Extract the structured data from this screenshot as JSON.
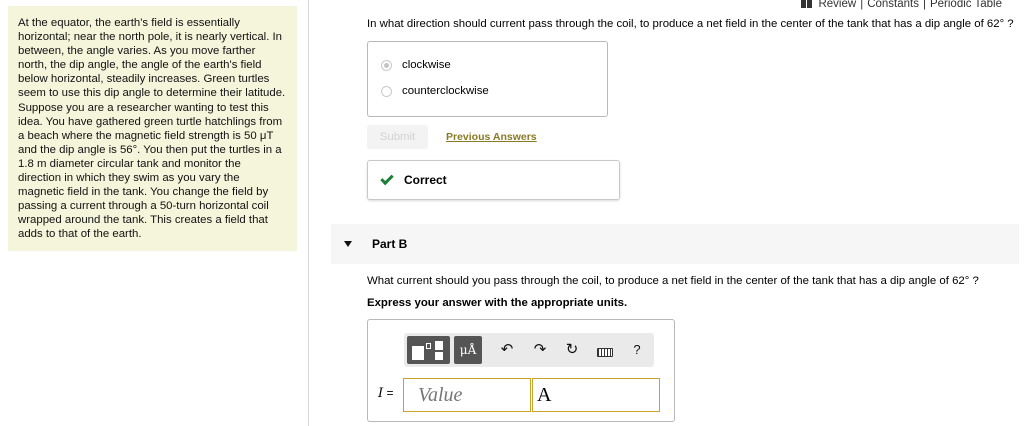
{
  "header": {
    "review": "Review",
    "constants": "Constants",
    "periodic_table": "Periodic Table",
    "separator": "|"
  },
  "intro": {
    "text": "At the equator, the earth's field is essentially horizontal; near the north pole, it is nearly vertical. In between, the angle varies. As you move farther north, the dip angle, the angle of the earth's field below horizontal, steadily increases. Green turtles seem to use this dip angle to determine their latitude. Suppose you are a researcher wanting to test this idea. You have gathered green turtle hatchlings from a beach where the magnetic field strength is 50 μT and the dip angle is 56°. You then put the turtles in a 1.8 m diameter circular tank and monitor the direction in which they swim as you vary the magnetic field in the tank. You change the field by passing a current through a 50-turn horizontal coil wrapped around the tank. This creates a field that adds to that of the earth."
  },
  "part_a": {
    "question": "In what direction should current pass through the coil, to produce a net field in the center of the tank that has a dip angle of 62° ?",
    "options": [
      "clockwise",
      "counterclockwise"
    ],
    "selected": "clockwise",
    "submit_label": "Submit",
    "previous_answers_label": "Previous Answers",
    "feedback": "Correct"
  },
  "part_b": {
    "label": "Part B",
    "question": "What current should you pass through the coil, to produce a net field in the center of the tank that has a dip angle of 62° ?",
    "instruction": "Express your answer with the appropriate units.",
    "toolbar": {
      "mu_label": "μÅ",
      "undo": "↶",
      "redo": "↷",
      "reset": "↻",
      "help": "?"
    },
    "variable": "I",
    "equals": "=",
    "value_placeholder": "Value",
    "unit_value": "A"
  },
  "colors": {
    "intro_bg": "#f5f5dc",
    "link_gold": "#8a7a26",
    "check_green": "#1e7f36",
    "input_border": "#c8a42c"
  }
}
